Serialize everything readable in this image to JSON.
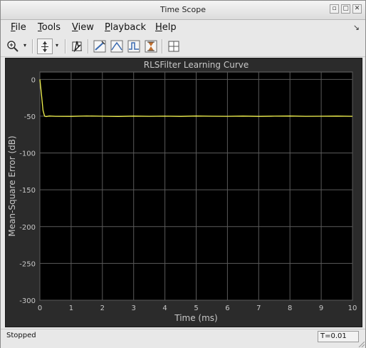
{
  "window": {
    "title": "Time Scope",
    "controls": [
      "restore-icon",
      "maximize-icon",
      "close-icon"
    ]
  },
  "menubar": {
    "items": [
      {
        "label": "File",
        "mnemonic": "F",
        "rest": "ile"
      },
      {
        "label": "Tools",
        "mnemonic": "T",
        "rest": "ools"
      },
      {
        "label": "View",
        "mnemonic": "V",
        "rest": "iew"
      },
      {
        "label": "Playback",
        "mnemonic": "P",
        "rest": "layback"
      },
      {
        "label": "Help",
        "mnemonic": "H",
        "rest": "elp"
      }
    ],
    "dock_icon": "undock-arrow-icon"
  },
  "toolbar": {
    "icons": [
      "zoom-in-icon",
      "axes-scaling-icon",
      "data-cursor-icon",
      "measurement-line-icon",
      "peak-finder-icon",
      "bilevel-measurements-icon",
      "signal-statistics-icon",
      "layout-grid-icon"
    ]
  },
  "colors": {
    "plot_bg": "#000000",
    "panel_bg": "#2b2b2b",
    "line": "#f2f24e",
    "grid": "#5a5a5a",
    "text": "#c8c8c8"
  },
  "chart_data": {
    "type": "line",
    "title": "RLSFilter Learning Curve",
    "xlabel": "Time (ms)",
    "ylabel": "Mean-Square Error (dB)",
    "xlim": [
      0,
      10
    ],
    "ylim": [
      -300,
      10
    ],
    "xticks": [
      "0",
      "1",
      "2",
      "3",
      "4",
      "5",
      "6",
      "7",
      "8",
      "9",
      "10"
    ],
    "yticks": [
      "0",
      "-50",
      "-100",
      "-150",
      "-200",
      "-250",
      "-300"
    ],
    "grid": true,
    "series": [
      {
        "x": [
          0,
          0.05,
          0.1,
          0.15,
          0.2,
          0.3,
          0.5,
          1,
          1.5,
          2,
          2.5,
          3,
          3.5,
          4,
          4.5,
          5,
          5.5,
          6,
          6.5,
          7,
          7.5,
          8,
          8.5,
          9,
          9.5,
          10
        ],
        "y": [
          0,
          -20,
          -42,
          -50,
          -50.5,
          -49.8,
          -50.2,
          -50.3,
          -49.7,
          -50.1,
          -50.4,
          -49.9,
          -50.2,
          -50.0,
          -50.3,
          -49.8,
          -50.1,
          -50.2,
          -49.9,
          -50.3,
          -50.0,
          -49.8,
          -50.2,
          -50.1,
          -49.9,
          -50.2
        ]
      }
    ]
  },
  "statusbar": {
    "status": "Stopped",
    "time": "T=0.01"
  }
}
